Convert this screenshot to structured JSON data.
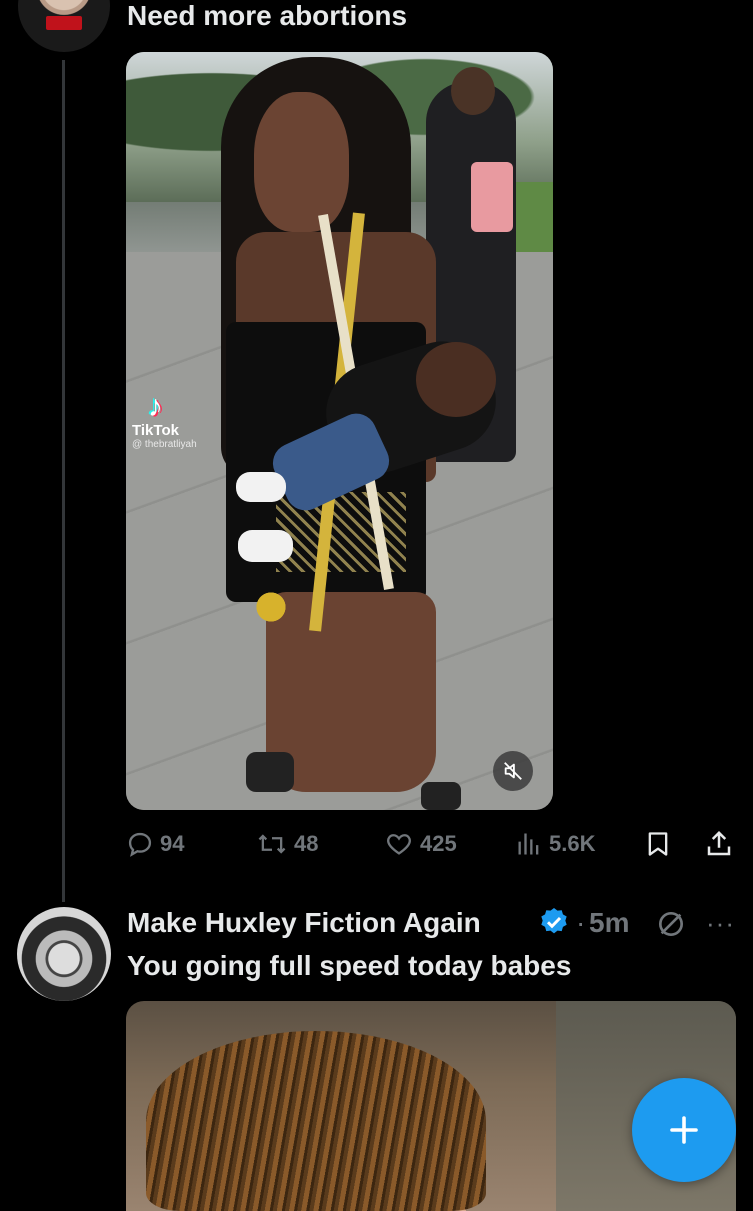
{
  "tweet1": {
    "text": "Need more abortions",
    "media": {
      "watermark_brand": "TikTok",
      "watermark_handle": "@ thebratliyah"
    },
    "actions": {
      "replies": "94",
      "reposts": "48",
      "likes": "425",
      "views": "5.6K"
    }
  },
  "tweet2": {
    "author_name": "Make Huxley Fiction Again",
    "separator": "·",
    "time": "5m",
    "more": "···",
    "text": "You going full speed today babes"
  },
  "icons": {
    "reply": "reply-icon",
    "repost": "repost-icon",
    "like": "heart-icon",
    "views": "views-icon",
    "bookmark": "bookmark-icon",
    "share": "share-icon",
    "mute": "mute-icon",
    "verified": "verified-badge-icon",
    "compose": "plus-icon"
  },
  "colors": {
    "background": "#000000",
    "text_primary": "#e7e9ea",
    "text_secondary": "#71767b",
    "accent": "#1d9bf0"
  }
}
